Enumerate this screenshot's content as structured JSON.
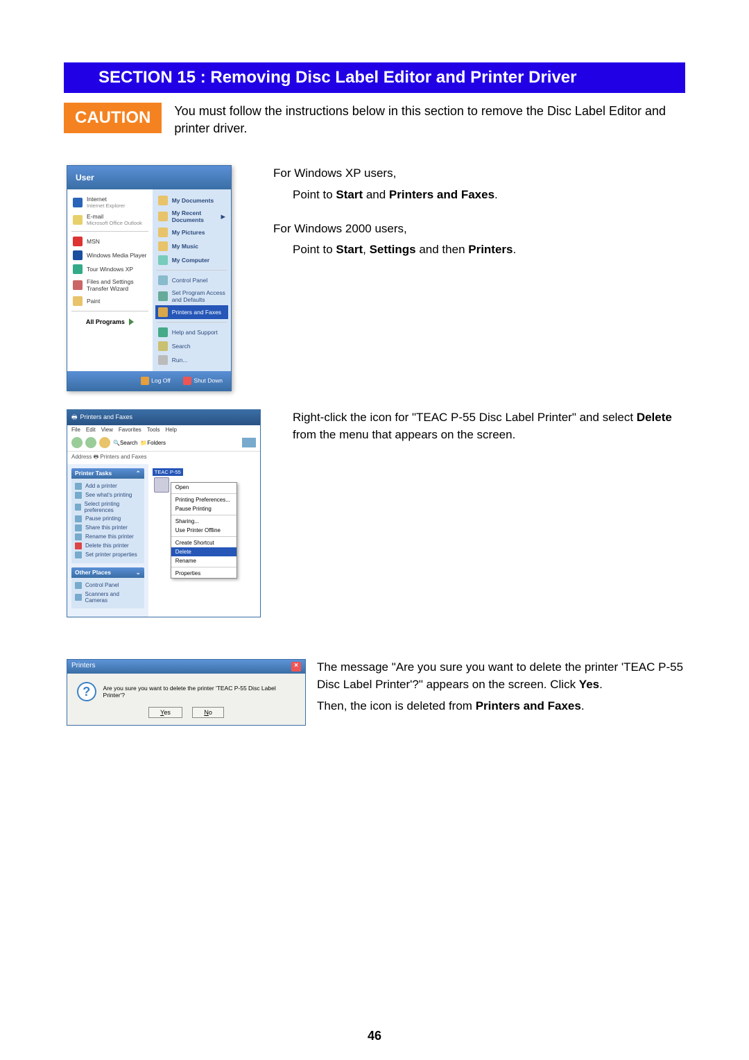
{
  "section_header": "SECTION 15 :  Removing Disc Label Editor and Printer Driver",
  "caution_label": "CAUTION",
  "caution_text": "You must follow the instructions below in this section to remove the Disc Label Editor and printer driver.",
  "step1": {
    "xp_line1": "For Windows XP users,",
    "xp_line2_pre": "Point to ",
    "xp_line2_b1": "Start",
    "xp_line2_mid": " and ",
    "xp_line2_b2": "Printers and Faxes",
    "w2k_line1": "For Windows 2000 users,",
    "w2k_line2_pre": "Point to ",
    "w2k_line2_b1": "Start",
    "w2k_line2_mid1": ", ",
    "w2k_line2_b2": "Settings",
    "w2k_line2_mid2": " and then ",
    "w2k_line2_b3": "Printers"
  },
  "step2": {
    "line1_pre": "Right-click the icon for \"TEAC P-55 Disc Label Printer\" and select ",
    "line1_b": "Delete",
    "line1_post": " from the menu that appears on the screen."
  },
  "step3": {
    "line1": "The message \"Are you sure you want to delete the printer 'TEAC P-55 Disc Label Printer'?\" appears on the screen. Click ",
    "line1_b": "Yes",
    "line1_post": ".",
    "line2_pre": "Then, the icon is deleted from ",
    "line2_b": "Printers and Faxes",
    "line2_post": "."
  },
  "start_menu": {
    "user": "User",
    "left": [
      {
        "title": "Internet",
        "sub": "Internet Explorer"
      },
      {
        "title": "E-mail",
        "sub": "Microsoft Office Outlook"
      },
      {
        "title": "MSN"
      },
      {
        "title": "Windows Media Player"
      },
      {
        "title": "Tour Windows XP"
      },
      {
        "title": "Files and Settings Transfer Wizard"
      },
      {
        "title": "Paint"
      }
    ],
    "all_programs": "All Programs",
    "right": [
      "My Documents",
      "My Recent Documents",
      "My Pictures",
      "My Music",
      "My Computer",
      "Control Panel",
      "Set Program Access and Defaults",
      "Printers and Faxes",
      "Help and Support",
      "Search",
      "Run..."
    ],
    "selected_right_index": 7,
    "log_off": "Log Off",
    "shut_down": "Shut Down"
  },
  "printers_window": {
    "title": "Printers and Faxes",
    "menus": [
      "File",
      "Edit",
      "View",
      "Favorites",
      "Tools",
      "Help"
    ],
    "toolbar": {
      "search": "Search",
      "folders": "Folders"
    },
    "address_label": "Address",
    "address": "Printers and Faxes",
    "tasks_header": "Printer Tasks",
    "tasks": [
      "Add a printer",
      "See what's printing",
      "Select printing preferences",
      "Pause printing",
      "Share this printer",
      "Rename this printer",
      "Delete this printer",
      "Set printer properties"
    ],
    "other_header": "Other Places",
    "other": [
      "Control Panel",
      "Scanners and Cameras"
    ],
    "printer_name": "TEAC P-55",
    "context_menu": [
      "Open",
      "Printing Preferences...",
      "Pause Printing",
      "Sharing...",
      "Use Printer Offline",
      "Create Shortcut",
      "Delete",
      "Rename",
      "Properties"
    ],
    "context_selected_index": 6
  },
  "dialog": {
    "title": "Printers",
    "message": "Are you sure you want to delete the printer 'TEAC P-55 Disc Label Printer'?",
    "yes": "Yes",
    "no": "No"
  },
  "page_number": "46"
}
